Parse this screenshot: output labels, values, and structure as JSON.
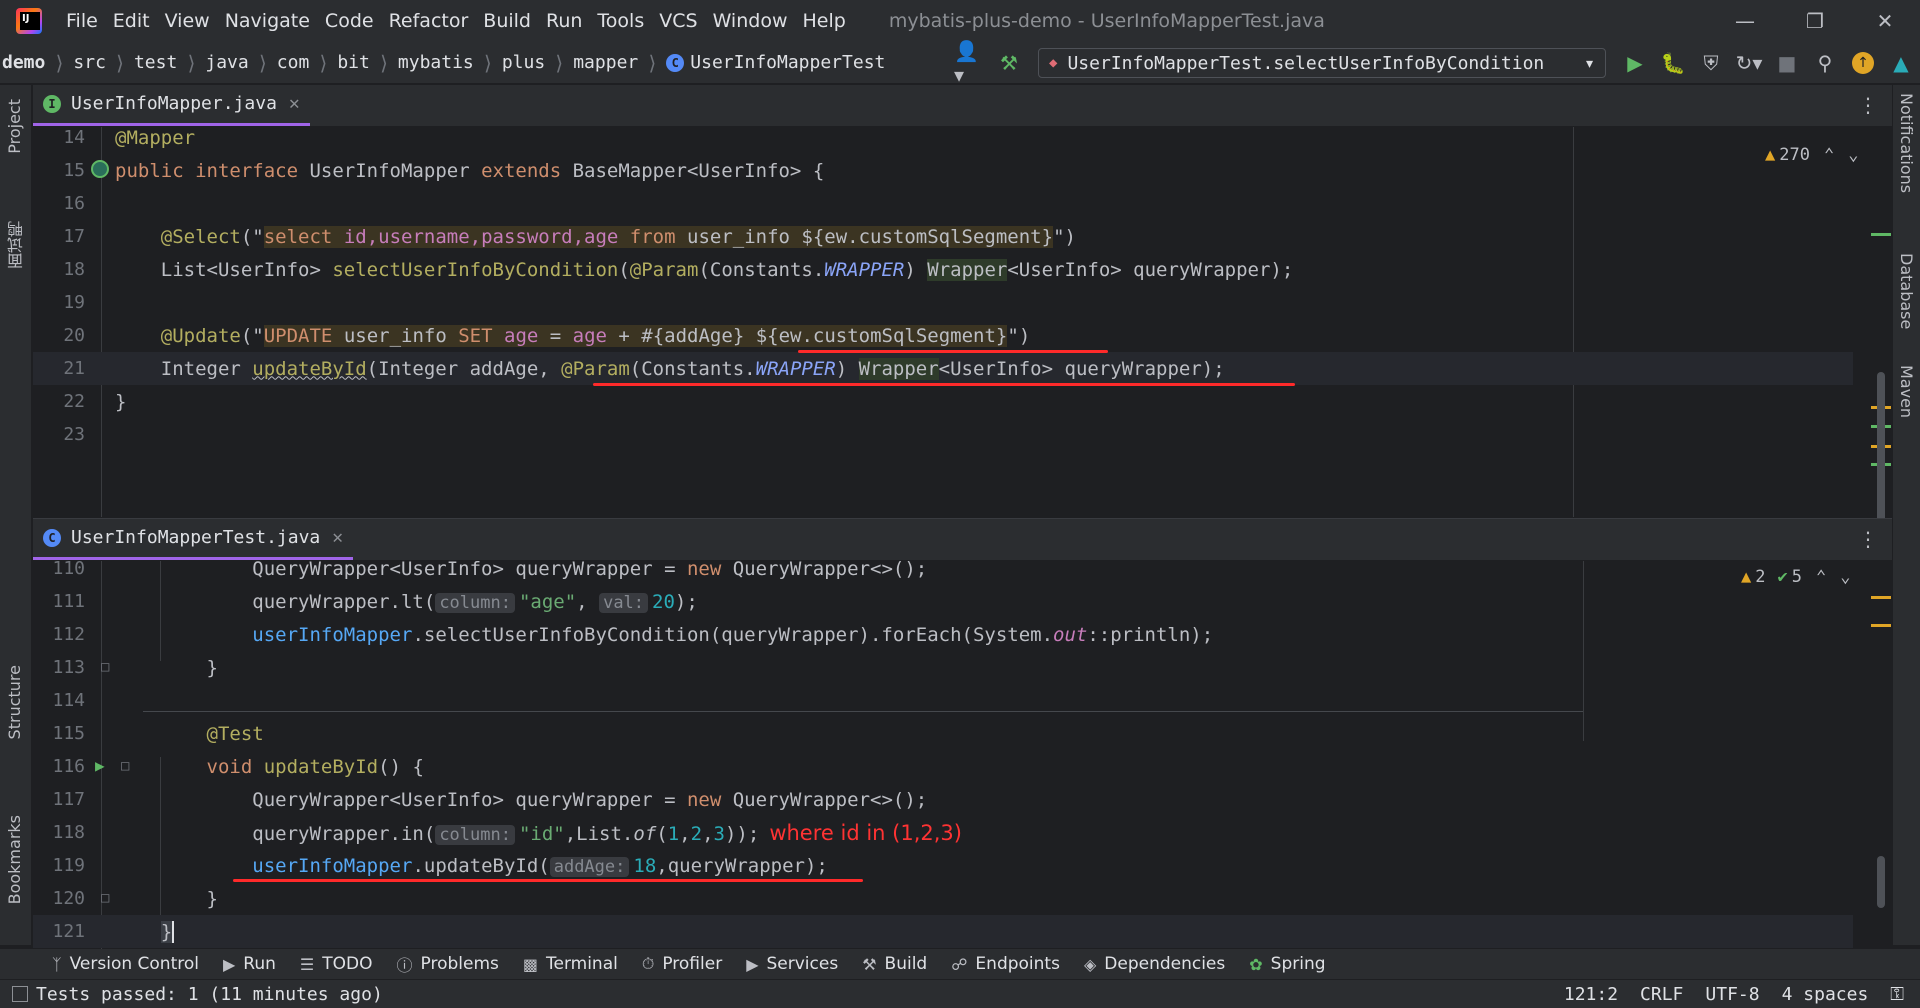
{
  "menubar": {
    "items": [
      "File",
      "Edit",
      "View",
      "Navigate",
      "Code",
      "Refactor",
      "Build",
      "Run",
      "Tools",
      "VCS",
      "Window",
      "Help"
    ],
    "title": "mybatis-plus-demo - UserInfoMapperTest.java"
  },
  "breadcrumbs": [
    "demo",
    "src",
    "test",
    "java",
    "com",
    "bit",
    "mybatis",
    "plus",
    "mapper",
    "UserInfoMapperTest"
  ],
  "run_config": {
    "label": "UserInfoMapperTest.selectUserInfoByCondition"
  },
  "left_tools": {
    "project": "Project",
    "side_cn": "面试鸭",
    "structure": "Structure",
    "bookmarks": "Bookmarks"
  },
  "right_tools": {
    "notifications": "Notifications",
    "database": "Database",
    "maven": "Maven"
  },
  "editor_top": {
    "tab": {
      "name": "UserInfoMapper.java",
      "icon": "I"
    },
    "warnings": "270",
    "lines": {
      "n14": "14",
      "n15": "15",
      "n16": "16",
      "n17": "17",
      "n18": "18",
      "n19": "19",
      "n20": "20",
      "n21": "21",
      "n22": "22",
      "n23": "23",
      "l14_ann": "@Mapper",
      "l15_kw1": "public",
      "l15_kw2": "interface",
      "l15_name": " UserInfoMapper ",
      "l15_kw3": "extends",
      "l15_rest": " BaseMapper<UserInfo> {",
      "l17_ann": "@Select",
      "l17_p1": "(\"",
      "l17_s1": "select ",
      "l17_ids": "id,username,password,age",
      "l17_from": " from ",
      "l17_tbl": "user_info ",
      "l17_seg": "${ew.customSqlSegment}",
      "l17_end": "\")",
      "l18_a": "List<UserInfo> ",
      "l18_fn": "selectUserInfoByCondition",
      "l18_b": "(",
      "l18_ann": "@Param",
      "l18_c": "(Constants.",
      "l18_const": "WRAPPER",
      "l18_d": ") ",
      "l18_e": "Wrapper",
      "l18_f": "<UserInfo> queryWrapper);",
      "l20_ann": "@Update",
      "l20_p1": "(\"",
      "l20_upd": "UPDATE",
      "l20_tbl": " user_info ",
      "l20_set": "SET",
      "l20_sp": " ",
      "l20_age1": "age",
      "l20_eq": " = ",
      "l20_age2": "age",
      "l20_plus": " + #{addAge} ",
      "l20_seg": "${ew.customSqlSegment}",
      "l20_end": "\")",
      "l21_a": "Integer ",
      "l21_fn": "updateById",
      "l21_b": "(Integer addAge, ",
      "l21_ann": "@Param",
      "l21_c": "(Constants.",
      "l21_const": "WRAPPER",
      "l21_d": ") ",
      "l21_e": "Wrapper",
      "l21_f": "<UserInfo> queryWrapper);",
      "l22": "}"
    }
  },
  "editor_bottom": {
    "tab": {
      "name": "UserInfoMapperTest.java",
      "icon": "C"
    },
    "warnings": "2",
    "oks": "5",
    "lines": {
      "n110": "110",
      "n111": "111",
      "n112": "112",
      "n113": "113",
      "n114": "114",
      "n115": "115",
      "n116": "116",
      "n117": "117",
      "n118": "118",
      "n119": "119",
      "n120": "120",
      "n121": "121",
      "l110_a": "QueryWrapper<UserInfo> queryWrapper = ",
      "l110_kw": "new",
      "l110_b": " QueryWrapper<>();",
      "l111_a": "queryWrapper.lt(",
      "l111_h1": "column:",
      "l111_s": "\"age\"",
      "l111_c": ",",
      "l111_h2": "val:",
      "l111_n": "20",
      "l111_d": ");",
      "l112_f": "userInfoMapper",
      "l112_a": ".selectUserInfoByCondition(queryWrapper).forEach(System.",
      "l112_out": "out",
      "l112_b": "::println);",
      "l113": "}",
      "l115_ann": "@Test",
      "l116_kw": "void",
      "l116_fn": " updateById",
      "l116_b": "() {",
      "l117_a": "QueryWrapper<UserInfo> queryWrapper = ",
      "l117_kw": "new",
      "l117_b": " QueryWrapper<>();",
      "l118_a": "queryWrapper.in(",
      "l118_h": "column:",
      "l118_s": "\"id\"",
      "l118_b": ",List.",
      "l118_of": "of",
      "l118_c": "(",
      "l118_n1": "1",
      "l118_d": ",",
      "l118_n2": "2",
      "l118_e": ",",
      "l118_n3": "3",
      "l118_f": "));",
      "l118_note": "where id in (1,2,3)",
      "l119_f": "userInfoMapper",
      "l119_a": ".updateById(",
      "l119_h": "addAge:",
      "l119_n": "18",
      "l119_b": ",queryWrapper);",
      "l120": "}",
      "l121": "}"
    }
  },
  "bottom_tools": [
    "Version Control",
    "Run",
    "TODO",
    "Problems",
    "Terminal",
    "Profiler",
    "Services",
    "Build",
    "Endpoints",
    "Dependencies",
    "Spring"
  ],
  "status": {
    "message": "Tests passed: 1 (11 minutes ago)",
    "position": "121:2",
    "line_sep": "CRLF",
    "encoding": "UTF-8",
    "indent": "4 spaces"
  },
  "colors": {
    "accent": "#a064e8",
    "annotation_red": "#ff2a2a",
    "keyword": "#cf8e6d",
    "function": "#56a8f5",
    "number": "#2aacb8"
  }
}
